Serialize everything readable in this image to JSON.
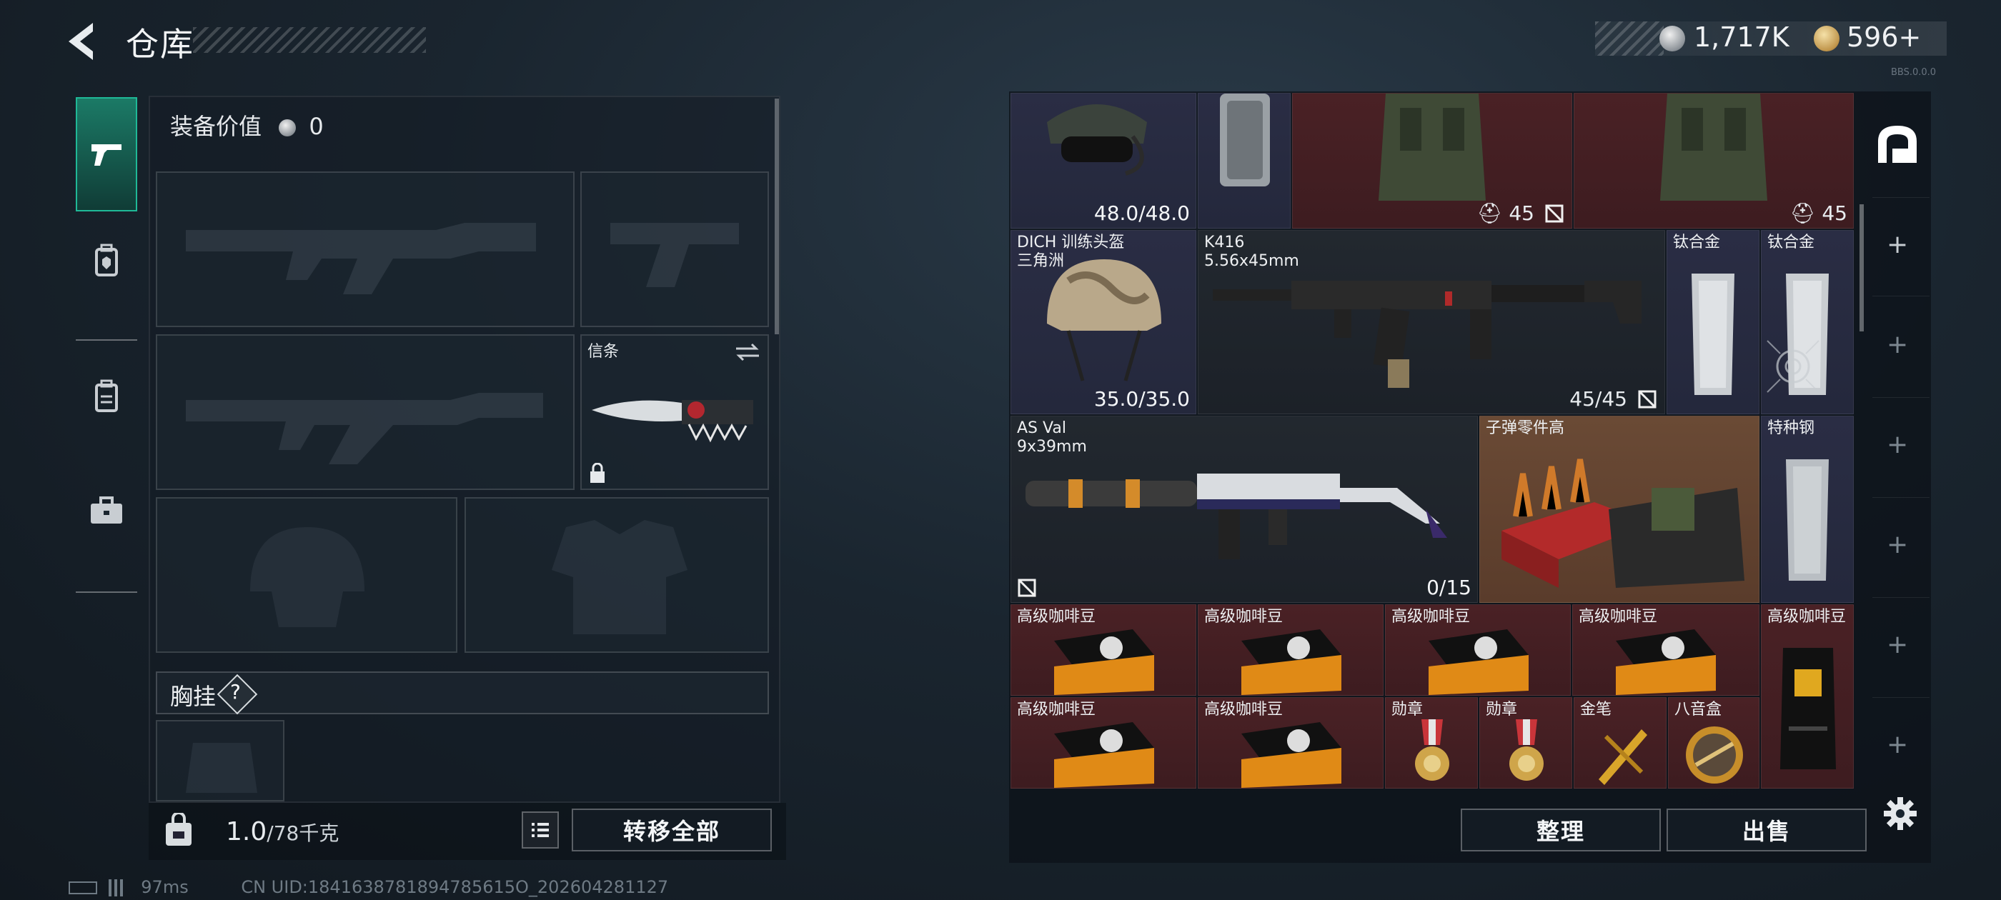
{
  "header": {
    "title": "仓库",
    "silver_amount": "1,717K",
    "gold_amount": "596+",
    "corner_tiny": "BBS.0.0.0"
  },
  "left": {
    "equip_value_label": "装备价值",
    "equip_value": "0",
    "card_slot_label": "信条",
    "chest_label": "胸挂",
    "chest_help": "?",
    "weight_value": "1.0",
    "weight_max": "/78千克",
    "transfer_all": "转移全部"
  },
  "grid": {
    "helmet_top_value": "48.0/48.0",
    "vest1_value": "45",
    "vest2_value": "45",
    "helmet2_label1": "DICH 训练头盔",
    "helmet2_label2": "三角洲",
    "helmet2_value": "35.0/35.0",
    "k416_label1": "K416",
    "k416_label2": "5.56x45mm",
    "k416_value": "45/45",
    "ti1_label": "钛合金",
    "ti2_label": "钛合金",
    "asval_label1": "AS Val",
    "asval_label2": "9x39mm",
    "asval_value": "0/15",
    "bullet_parts_label": "子弹零件高",
    "special_steel_label": "特种钢",
    "coffee_label": "高级咖啡豆",
    "medal_label": "勋章",
    "gold_pen_label": "金笔",
    "music_box_label": "八音盒",
    "coffee_items": [
      "高级咖啡豆",
      "高级咖啡豆",
      "高级咖啡豆",
      "高级咖啡豆",
      "高级咖啡豆",
      "高级咖啡豆",
      "高级咖啡豆"
    ],
    "medals": [
      "勋章",
      "勋章"
    ]
  },
  "buttons": {
    "sort": "整理",
    "sell": "出售"
  },
  "status": {
    "ping": "97ms",
    "uid": "CN UID:1841638781894785615O_202604281127"
  },
  "colors": {
    "accent": "#1fb997",
    "red_cell": "#4a2125",
    "blue_cell": "#2a2d44"
  }
}
